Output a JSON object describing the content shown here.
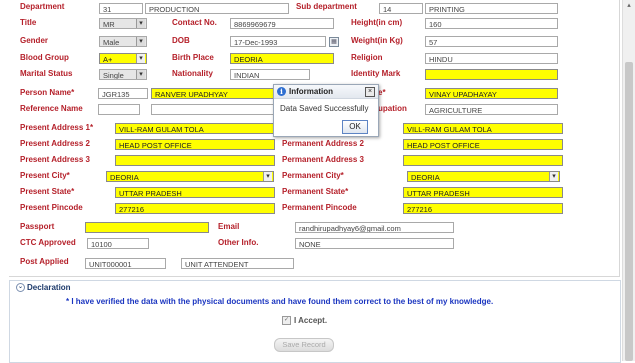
{
  "form": {
    "department_label": "Department",
    "department_code": "31",
    "department_name": "PRODUCTION",
    "sub_department_label": "Sub department",
    "sub_department_code": "14",
    "sub_department_name": "PRINTING",
    "title_label": "Title",
    "title_value": "MR",
    "contact_label": "Contact No.",
    "contact_value": "8869969679",
    "height_label": "Height(in cm)",
    "height_value": "160",
    "gender_label": "Gender",
    "gender_value": "Male",
    "dob_label": "DOB",
    "dob_value": "17-Dec-1993",
    "weight_label": "Weight(in Kg)",
    "weight_value": "57",
    "blood_group_label": "Blood Group",
    "blood_group_value": "A+",
    "birth_place_label": "Birth Place",
    "birth_place_value": "DEORIA",
    "religion_label": "Religion",
    "religion_value": "HINDU",
    "marital_label": "Marital Status",
    "marital_value": "Single",
    "nationality_label": "Nationality",
    "nationality_value": "INDIAN",
    "identity_mark_label": "Identity Mark",
    "identity_mark_value": "",
    "person_name_label": "Person Name*",
    "person_code": "JGR135",
    "person_name_value": "RANVER UPADHYAY",
    "father_name_label_partial": "e*",
    "father_name_value": "VINAY UPADHAYAY",
    "reference_name_label": "Reference Name",
    "occupation_label_partial": "upation",
    "occupation_value": "AGRICULTURE",
    "present_address1_label": "Present Address 1*",
    "present_address1_value": "VILL-RAM GULAM TOLA",
    "permanent_address1_value": "VILL-RAM GULAM TOLA",
    "present_address2_label": "Present Address 2",
    "present_address2_value": "HEAD POST OFFICE",
    "permanent_address2_label": "Permanent Address 2",
    "permanent_address2_value": "HEAD POST OFFICE",
    "present_address3_label": "Present Address 3",
    "permanent_address3_label": "Permanent Address 3",
    "present_city_label": "Present City*",
    "present_city_value": "DEORIA",
    "permanent_city_label": "Permanent City*",
    "permanent_city_value": "DEORIA",
    "present_state_label": "Present State*",
    "present_state_value": "UTTAR PRADESH",
    "permanent_state_label": "Permanent State*",
    "permanent_state_value": "UTTAR PRADESH",
    "present_pincode_label": "Present Pincode",
    "present_pincode_value": "277216",
    "permanent_pincode_label": "Permanent Pincode",
    "permanent_pincode_value": "277216",
    "passport_label": "Passport",
    "email_label": "Email",
    "email_value": "randhirupadhyay6@gmail.com",
    "ctc_label": "CTC Approved",
    "ctc_value": "10100",
    "other_info_label": "Other Info.",
    "other_info_value": "NONE",
    "post_applied_label": "Post Applied",
    "post_code": "UNIT000001",
    "post_name": "UNIT ATTENDENT"
  },
  "declaration": {
    "header": "Declaration",
    "text": "* I have verified the data with the physical documents and have found them correct to the best of my knowledge.",
    "accept_label": "I Accept.",
    "save_button": "Save Record"
  },
  "dialog": {
    "title": "Information",
    "message": "Data Saved Successfully",
    "ok_button": "OK",
    "icon": "info-icon"
  },
  "colors": {
    "label": "#b5202a",
    "highlight": "#ffff00",
    "declaration_text": "#1a35c0"
  }
}
